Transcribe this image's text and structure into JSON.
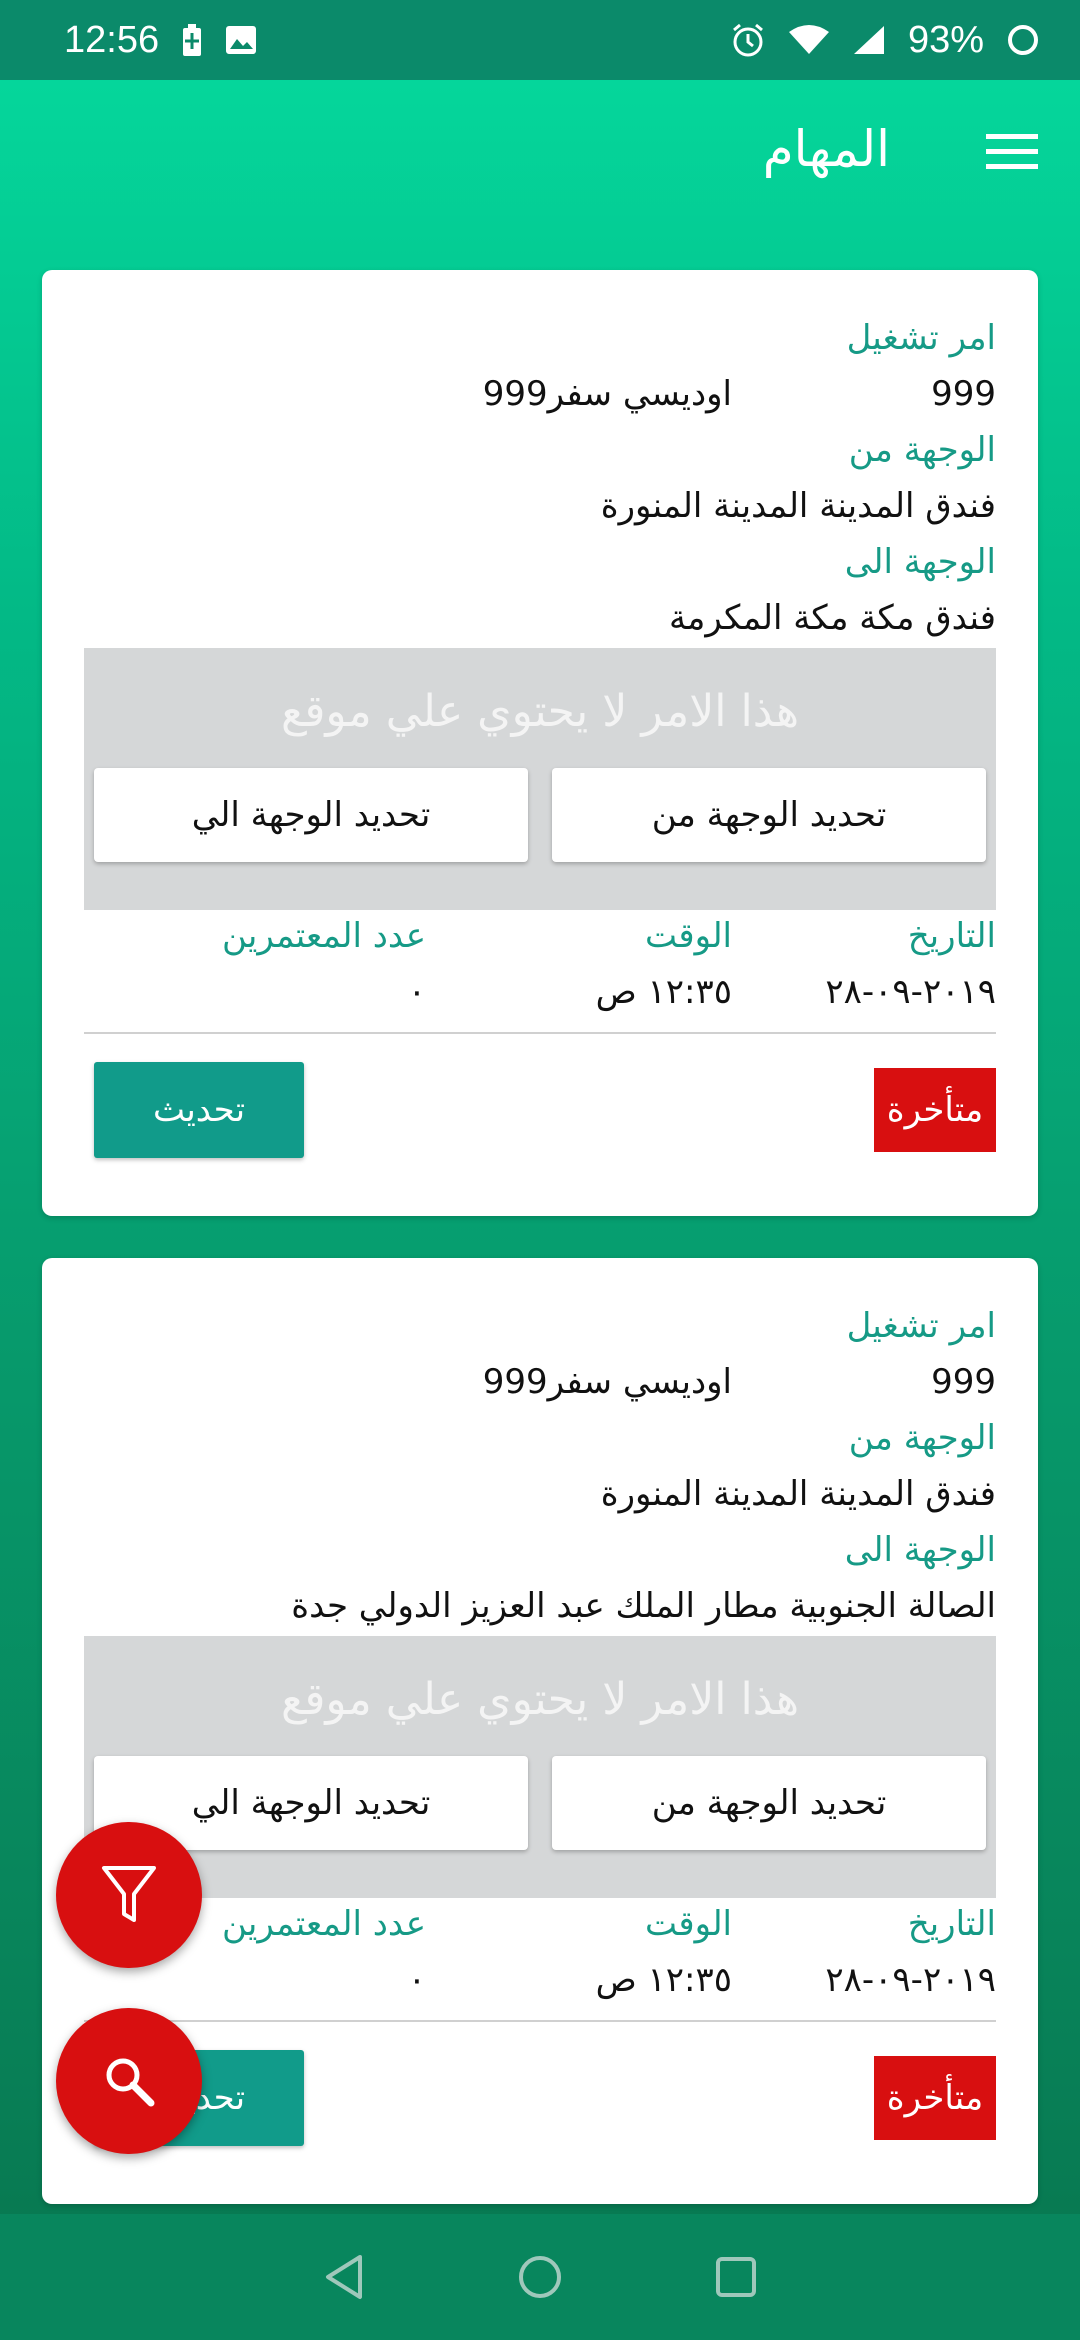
{
  "status_bar": {
    "time": "12:56",
    "battery": "93%",
    "icons": [
      "battery-charging-icon",
      "image-icon",
      "alarm-icon",
      "wifi-icon",
      "signal-icon",
      "battery-ring-icon"
    ]
  },
  "app_bar": {
    "title": "المهام",
    "menu_icon": "hamburger-menu-icon"
  },
  "labels": {
    "order": "امر تشغيل",
    "from": "الوجهة من",
    "to": "الوجهة الى",
    "no_location": "هذا الامر لا يحتوي علي موقع",
    "set_to": "تحديد الوجهة الي",
    "set_from": "تحديد الوجهة من",
    "date": "التاريخ",
    "time": "الوقت",
    "pilgrims": "عدد المعتمرين",
    "update": "تحديث",
    "late": "متأخرة"
  },
  "cards": [
    {
      "order_no": "999",
      "order_name": "اوديسي سفر999",
      "from": "فندق المدينة المدينة المنورة",
      "to": "فندق مكة مكة المكرمة",
      "date": "٢٠١٩-٠٩-٢٨",
      "time": "١٢:٣٥ ص",
      "pilgrims": "٠"
    },
    {
      "order_no": "999",
      "order_name": "اوديسي سفر999",
      "from": "فندق المدينة المدينة المنورة",
      "to": "الصالة الجنوبية مطار الملك عبد العزيز الدولي جدة",
      "date": "٢٠١٩-٠٩-٢٨",
      "time": "١٢:٣٥ ص",
      "pilgrims": "٠"
    }
  ],
  "fabs": {
    "filter_icon": "filter-icon",
    "search_icon": "search-icon"
  },
  "nav": {
    "icons": [
      "back-icon",
      "home-icon",
      "recents-icon"
    ]
  },
  "colors": {
    "accent_teal": "#169a86",
    "button_teal": "#119b8a",
    "late_red": "#d80f10",
    "gradient_top": "#05d69b",
    "gradient_bottom": "#087a52"
  }
}
